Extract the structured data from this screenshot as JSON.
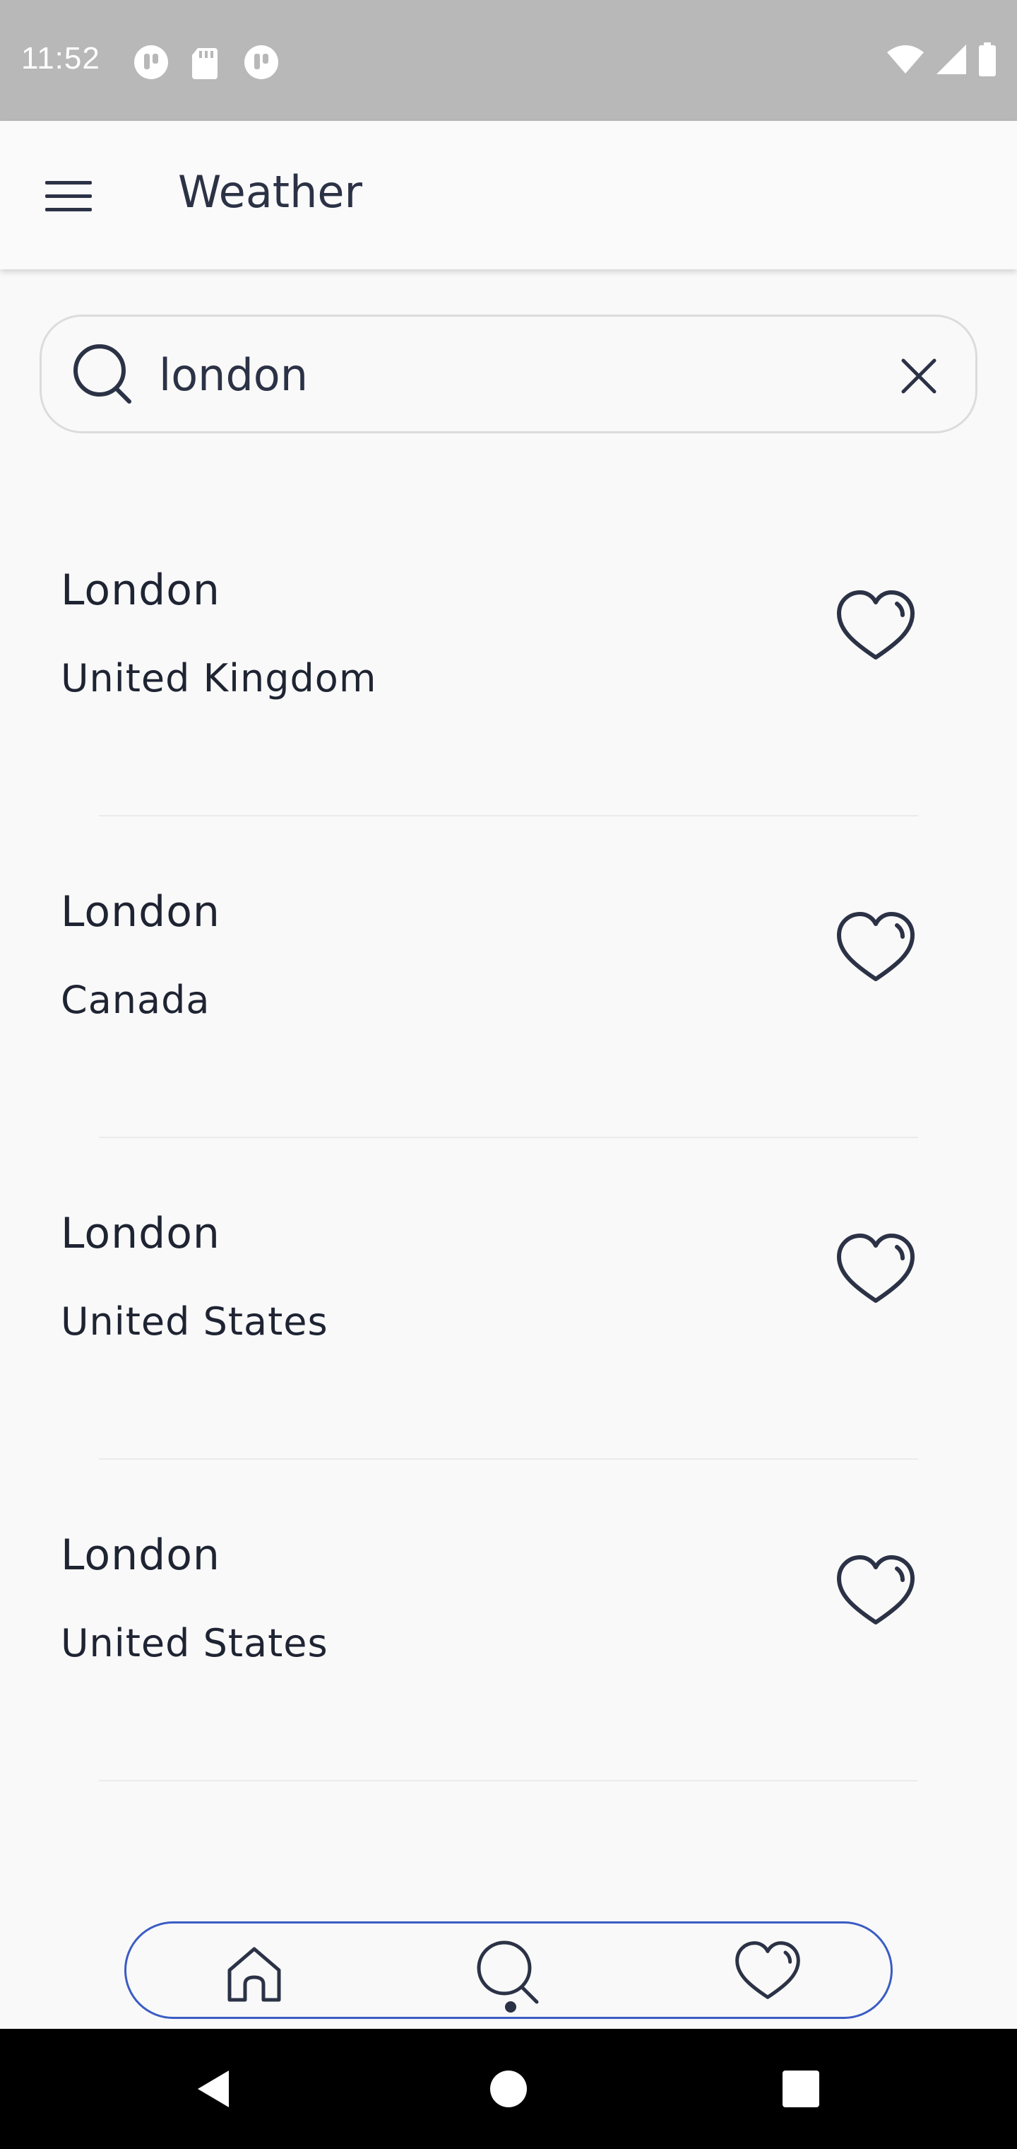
{
  "status_bar": {
    "time": "11:52",
    "icons_left": [
      "notification-app-icon",
      "sd-card-icon",
      "notification-app-icon"
    ],
    "icons_right": [
      "wifi-icon",
      "signal-icon",
      "battery-icon"
    ]
  },
  "app_bar": {
    "title": "Weather",
    "menu_icon": "hamburger-menu-icon"
  },
  "search": {
    "value": "london",
    "placeholder": "",
    "icon": "search-icon",
    "clear_icon": "close-icon"
  },
  "results": [
    {
      "city": "London",
      "country": "United Kingdom",
      "favorite": false
    },
    {
      "city": "London",
      "country": "Canada",
      "favorite": false
    },
    {
      "city": "London",
      "country": "United States",
      "favorite": false
    },
    {
      "city": "London",
      "country": "United States",
      "favorite": false
    }
  ],
  "bottom_nav": {
    "items": [
      {
        "name": "home",
        "icon": "home-icon",
        "active": false
      },
      {
        "name": "search",
        "icon": "search-icon",
        "active": true
      },
      {
        "name": "favorites",
        "icon": "heart-icon",
        "active": false
      }
    ],
    "accent_color": "#3a5cc4"
  },
  "colors": {
    "status_bar": "#b8b8b8",
    "background": "#f9f9f9",
    "text": "#1f2433",
    "system_nav": "#000000"
  }
}
